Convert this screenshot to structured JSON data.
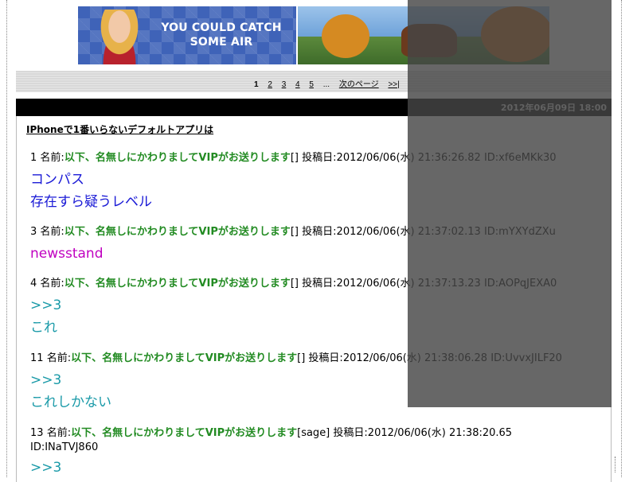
{
  "banner": {
    "text_line1": "YOU COULD CATCH",
    "text_line2": "SOME AIR"
  },
  "pager": {
    "current": "1",
    "pages": [
      "2",
      "3",
      "4",
      "5"
    ],
    "ellipsis": "...",
    "next_label": "次のページ",
    "last_label": ">>|"
  },
  "post": {
    "date": "2012年06月09日 18:00",
    "title": "IPhoneで1番いらないデフォルトアプリは"
  },
  "responses": [
    {
      "num": "1",
      "name_label": "名前:",
      "name": "以下、名無しにかわりましてVIPがお送りします",
      "mail": "[]",
      "posted_label": "投稿日:",
      "date": "2012/06/06(水) 21:36:26.82 ID:xf6eMKk30",
      "body": [
        "コンパス",
        "存在すら疑うレベル"
      ]
    },
    {
      "num": "3",
      "name_label": "名前:",
      "name": "以下、名無しにかわりましてVIPがお送りします",
      "mail": "[]",
      "posted_label": "投稿日:",
      "date": "2012/06/06(水) 21:37:02.13 ID:mYXYdZXu",
      "body": [
        "newsstand"
      ]
    },
    {
      "num": "4",
      "name_label": "名前:",
      "name": "以下、名無しにかわりましてVIPがお送りします",
      "mail": "[]",
      "posted_label": "投稿日:",
      "date": "2012/06/06(水) 21:37:13.23 ID:AOPqJEXA0",
      "body": [
        ">>3",
        "これ"
      ]
    },
    {
      "num": "11",
      "name_label": "名前:",
      "name": "以下、名無しにかわりましてVIPがお送りします",
      "mail": "[]",
      "posted_label": "投稿日:",
      "date": "2012/06/06(水) 21:38:06.28 ID:UvvxJILF20",
      "body": [
        ">>3",
        "これしかない"
      ]
    },
    {
      "num": "13",
      "name_label": "名前:",
      "name": "以下、名無しにかわりましてVIPがお送りします",
      "mail": "[sage]",
      "posted_label": "投稿日:",
      "date": "2012/06/06(水) 21:38:20.65",
      "id": "ID:INaTVJ860",
      "body": [
        ">>3"
      ]
    }
  ],
  "colors": {
    "name_green": "#228b22",
    "body_blue": "#1a1ad6",
    "body_magenta": "#c000c0",
    "body_teal": "#1a9aa8"
  }
}
